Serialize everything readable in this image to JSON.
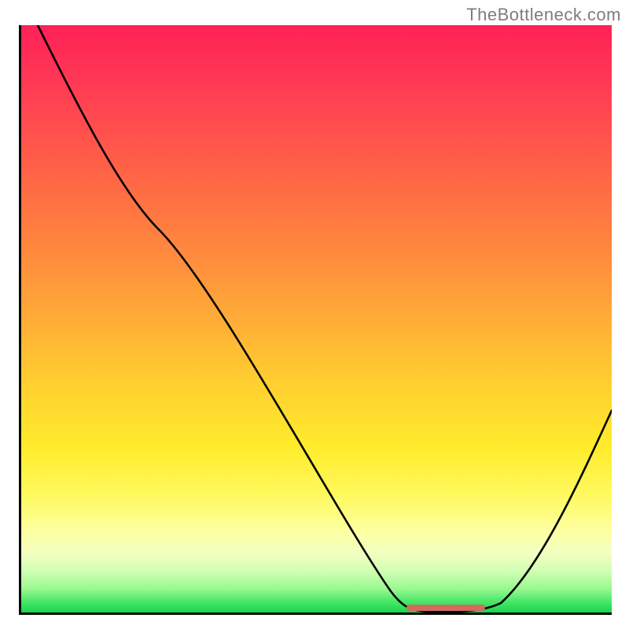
{
  "attribution": "TheBottleneck.com",
  "marker": {
    "style": "left:490px; width:100px; bottom:2px;"
  },
  "colors": {
    "axis": "#000000",
    "curve": "#000000",
    "marker": "#d46a5f",
    "attribution_text": "#7d7d7d",
    "gradient_top": "#ff2157",
    "gradient_bottom": "#17d64a"
  },
  "chart_data": {
    "type": "line",
    "title": "",
    "xlabel": "",
    "ylabel": "",
    "xlim": [
      0,
      100
    ],
    "ylim": [
      0,
      100
    ],
    "grid": false,
    "legend": false,
    "x": [
      3,
      10,
      18,
      23,
      30,
      40,
      50,
      58,
      63,
      67,
      72,
      77,
      82,
      88,
      94,
      100
    ],
    "values": [
      100,
      84,
      70,
      65,
      56,
      42,
      28,
      16,
      7,
      2,
      0,
      0,
      2,
      12,
      25,
      35
    ],
    "annotations": [
      {
        "text": "TheBottleneck.com",
        "position": "top-right"
      }
    ],
    "optimal_range_x": [
      65,
      79
    ]
  }
}
